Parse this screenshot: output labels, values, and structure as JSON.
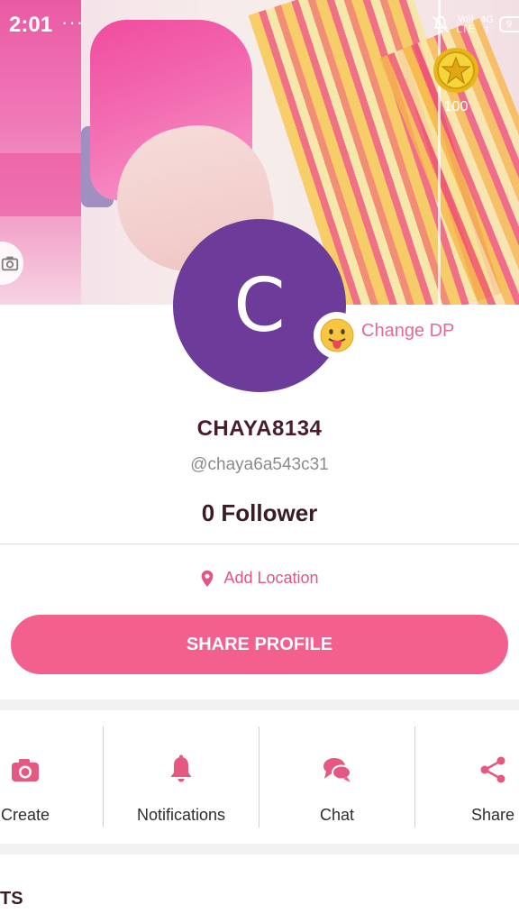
{
  "status_bar": {
    "time": "2:01",
    "dots": "···",
    "volte_top": "Vo))",
    "volte_bottom": "LTE",
    "network": "4G",
    "battery": "9"
  },
  "cover": {
    "coin_value": "100"
  },
  "profile": {
    "avatar_initial": "C",
    "change_dp_label": "Change DP",
    "username": "CHAYA8134",
    "handle": "@chaya6a543c31",
    "followers_text": "0 Follower",
    "add_location_label": "Add Location",
    "share_profile_label": "SHARE PROFILE"
  },
  "actions": [
    {
      "label": "Create",
      "icon": "camera-icon"
    },
    {
      "label": "Notifications",
      "icon": "bell-icon"
    },
    {
      "label": "Chat",
      "icon": "chat-bubbles-icon"
    },
    {
      "label": "Share",
      "icon": "share-icon"
    }
  ],
  "section": {
    "title_fragment": "TS"
  },
  "colors": {
    "accent": "#f4608d",
    "avatar_bg": "#6d3b9a",
    "text_dark": "#3a1c25",
    "icon_pink": "#e5587f"
  }
}
